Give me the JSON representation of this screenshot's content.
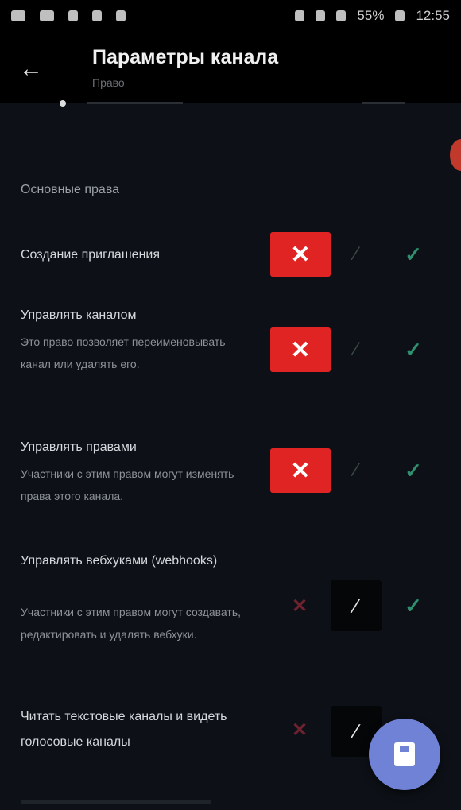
{
  "status_bar": {
    "battery": "55%",
    "time": "12:55"
  },
  "app_bar": {
    "back_glyph": "←",
    "title": "Параметры канала",
    "subtitle": "Право"
  },
  "section": {
    "title": "Основные права"
  },
  "permissions": [
    {
      "name": "Создание приглашения",
      "description": "",
      "state": "deny"
    },
    {
      "name": "Управлять каналом",
      "description": "Это право позволяет переименовывать канал или удалять его.",
      "state": "deny"
    },
    {
      "name": "Управлять правами",
      "description": "Участники с этим правом могут изменять права этого канала.",
      "state": "deny"
    },
    {
      "name": "Управлять вебхуками (webhooks)",
      "description": "Участники с этим правом могут создавать, редактировать и удалять вебхуки.",
      "state": "neutral"
    },
    {
      "name": "Читать текстовые каналы и видеть голосовые каналы",
      "description": "",
      "state": "neutral"
    }
  ],
  "glyphs": {
    "deny": "✕",
    "neutral": "∕",
    "allow": "✓"
  },
  "colors": {
    "deny_active": "#e02424",
    "allow": "#2f8f6f",
    "fab": "#6f82d6"
  }
}
